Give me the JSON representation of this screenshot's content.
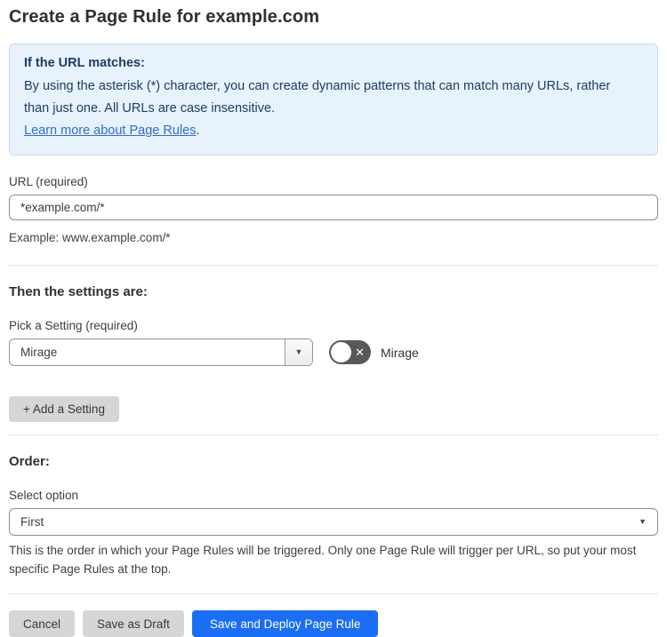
{
  "page": {
    "title": "Create a Page Rule for example.com"
  },
  "info_box": {
    "heading": "If the URL matches:",
    "body": "By using the asterisk (*) character, you can create dynamic patterns that can match many URLs, rather than just one. All URLs are case insensitive.",
    "link_label": "Learn more about Page Rules",
    "link_suffix": "."
  },
  "url_field": {
    "label": "URL (required)",
    "value": "*example.com/*",
    "helper": "Example: www.example.com/*"
  },
  "settings_section": {
    "heading": "Then the settings are:",
    "picker_label": "Pick a Setting (required)",
    "picker_value": "Mirage",
    "toggle_label": "Mirage",
    "toggle_state": "off",
    "toggle_icon": "✕",
    "caret_icon": "▼",
    "add_button_label": "+ Add a Setting"
  },
  "order_section": {
    "heading": "Order:",
    "label": "Select option",
    "value": "First",
    "caret_icon": "▼",
    "helper": "This is the order in which your Page Rules will be triggered. Only one Page Rule will trigger per URL, so put your most specific Page Rules at the top."
  },
  "footer": {
    "cancel_label": "Cancel",
    "save_draft_label": "Save as Draft",
    "save_deploy_label": "Save and Deploy Page Rule"
  },
  "colors": {
    "accent_blue": "#1a6ef5",
    "link_blue": "#2c6ecb",
    "info_bg": "#e8f2fc",
    "info_border": "#c3dcf3",
    "info_text": "#1e3c64",
    "toggle_off_bg": "#595959",
    "button_gray": "#d6d6d6"
  }
}
